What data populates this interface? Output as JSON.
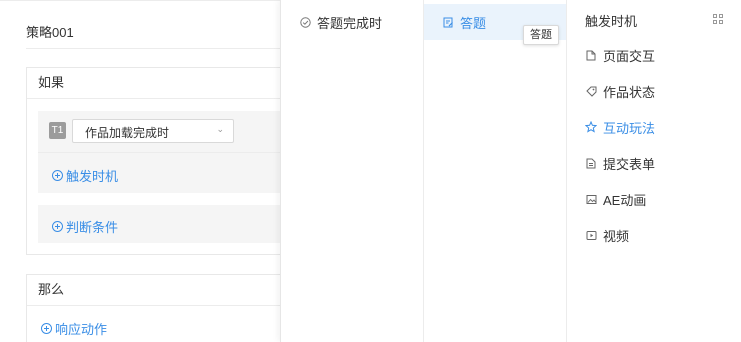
{
  "strategy": {
    "title": "策略001"
  },
  "if_card": {
    "heading": "如果",
    "trigger_badge": "T1",
    "trigger_select": {
      "value": "作品加载完成时"
    },
    "add_trigger_label": "触发时机",
    "add_condition_label": "判断条件"
  },
  "then_card": {
    "heading": "那么",
    "add_action_label": "响应动作"
  },
  "cascader": {
    "level1": [
      {
        "label": "答题完成时",
        "icon": "check-circle-icon"
      }
    ],
    "level2": [
      {
        "label": "答题",
        "icon": "edit-note-icon",
        "active": true
      }
    ],
    "level2_tooltip": "答题",
    "level3_heading": "触发时机",
    "level3": [
      {
        "label": "页面交互",
        "icon": "page-icon"
      },
      {
        "label": "作品状态",
        "icon": "tag-icon"
      },
      {
        "label": "互动玩法",
        "icon": "star-icon",
        "highlighted": true
      },
      {
        "label": "提交表单",
        "icon": "form-icon"
      },
      {
        "label": "AE动画",
        "icon": "image-icon"
      },
      {
        "label": "视频",
        "icon": "video-icon"
      }
    ]
  },
  "colors": {
    "accent": "#3a8ee6",
    "active_bg": "#eaf3fc",
    "panel_bg": "#f5f5f5"
  }
}
